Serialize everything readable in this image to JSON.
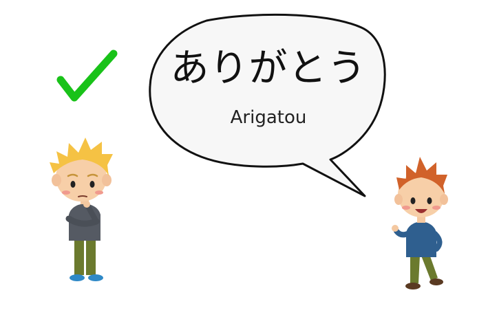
{
  "speech_bubble": {
    "japanese": "ありがとう",
    "romaji": "Arigatou"
  },
  "icons": {
    "check": "check-mark-icon"
  },
  "colors": {
    "check": "#19c219",
    "bubble_fill": "#f7f7f7",
    "bubble_stroke": "#111111"
  }
}
